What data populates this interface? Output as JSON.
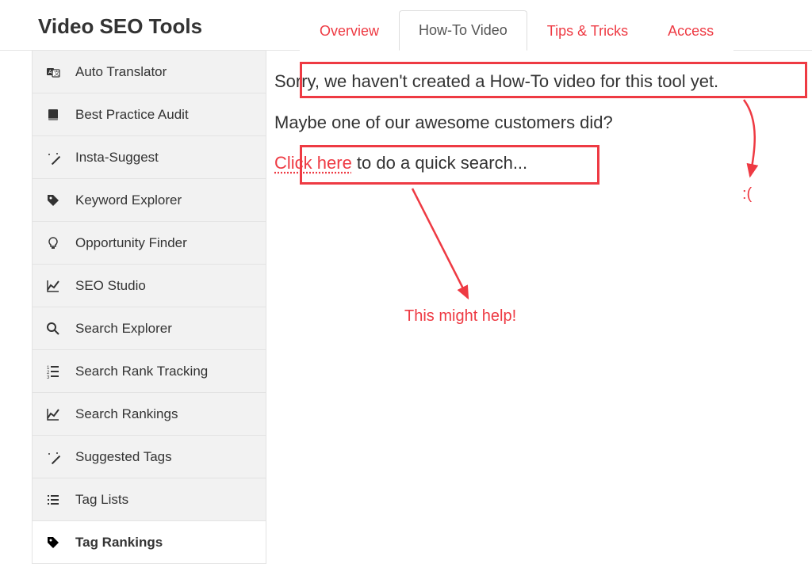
{
  "page_title": "Video SEO Tools",
  "tabs": [
    {
      "label": "Overview",
      "active": false
    },
    {
      "label": "How-To Video",
      "active": true
    },
    {
      "label": "Tips & Tricks",
      "active": false
    },
    {
      "label": "Access",
      "active": false
    }
  ],
  "sidebar": {
    "items": [
      {
        "label": "Auto Translator",
        "icon": "translate-icon",
        "active": false
      },
      {
        "label": "Best Practice Audit",
        "icon": "book-icon",
        "active": false
      },
      {
        "label": "Insta-Suggest",
        "icon": "wand-icon",
        "active": false
      },
      {
        "label": "Keyword Explorer",
        "icon": "tag-icon",
        "active": false
      },
      {
        "label": "Opportunity Finder",
        "icon": "lightbulb-icon",
        "active": false
      },
      {
        "label": "SEO Studio",
        "icon": "chart-line-icon",
        "active": false
      },
      {
        "label": "Search Explorer",
        "icon": "search-icon",
        "active": false
      },
      {
        "label": "Search Rank Tracking",
        "icon": "list-ordered-icon",
        "active": false
      },
      {
        "label": "Search Rankings",
        "icon": "chart-line-icon",
        "active": false
      },
      {
        "label": "Suggested Tags",
        "icon": "wand-icon",
        "active": false
      },
      {
        "label": "Tag Lists",
        "icon": "list-icon",
        "active": false
      },
      {
        "label": "Tag Rankings",
        "icon": "tag-icon",
        "active": true
      }
    ]
  },
  "content": {
    "line1": "Sorry, we haven't created a How-To video for this tool yet.",
    "line2": "Maybe one of our awesome customers did?",
    "link_text": "Click here",
    "line3_rest": " to do a quick search..."
  },
  "annotations": {
    "sad": ":(",
    "help": "This might help!"
  }
}
